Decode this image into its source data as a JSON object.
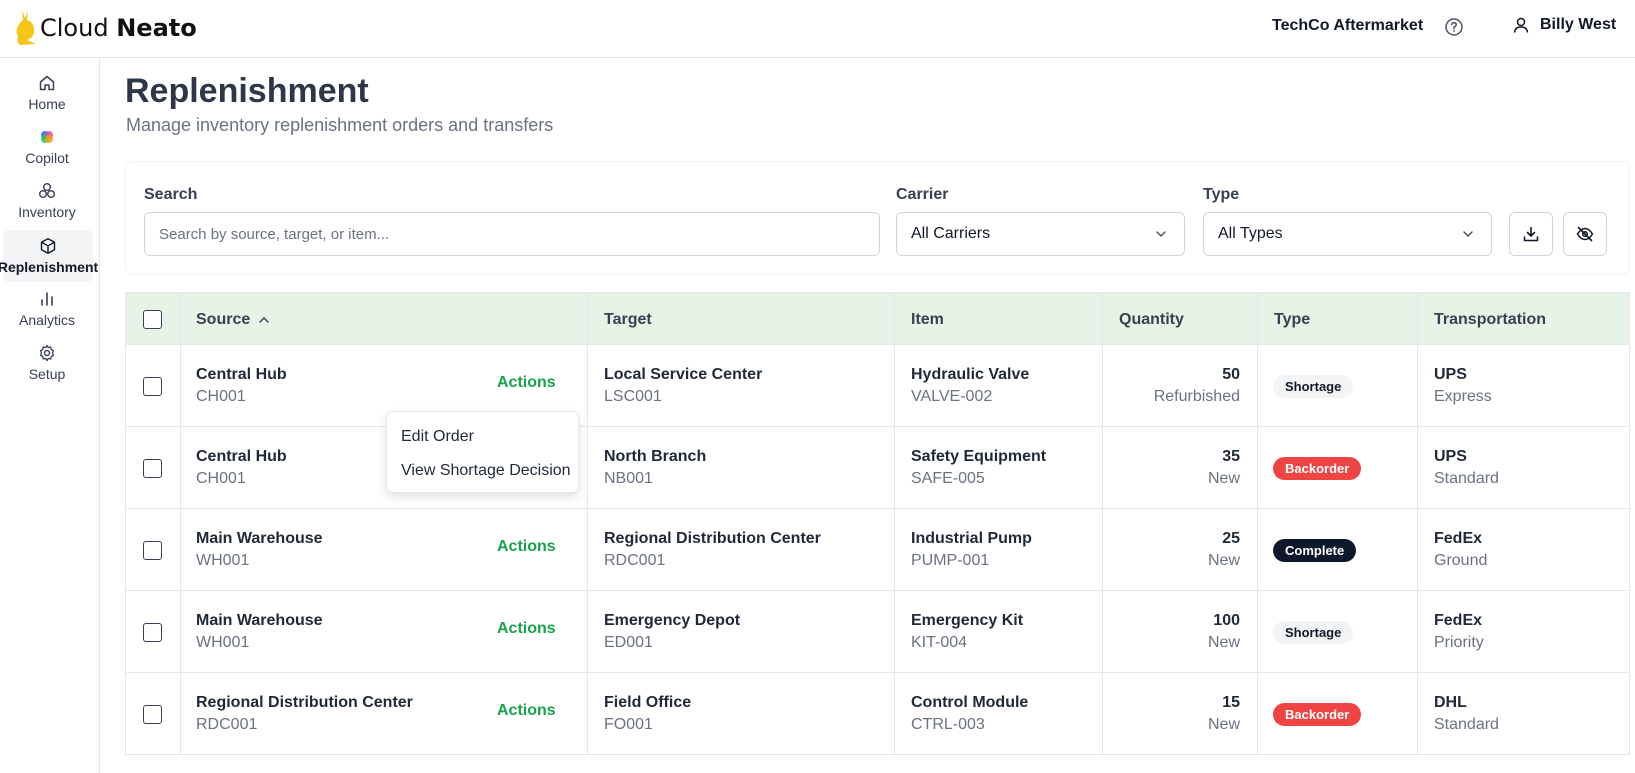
{
  "header": {
    "brand_prefix": "Cloud",
    "brand_name": "Neato",
    "org": "TechCo Aftermarket",
    "user_name": "Billy West"
  },
  "sidebar": {
    "items": [
      {
        "label": "Home",
        "icon": "home-icon"
      },
      {
        "label": "Copilot",
        "icon": "copilot-icon"
      },
      {
        "label": "Inventory",
        "icon": "inventory-icon"
      },
      {
        "label": "Replenishment",
        "icon": "package-icon",
        "active": true
      },
      {
        "label": "Analytics",
        "icon": "bar-chart-icon"
      },
      {
        "label": "Setup",
        "icon": "gear-icon"
      }
    ]
  },
  "page": {
    "title": "Replenishment",
    "subtitle": "Manage inventory replenishment orders and transfers"
  },
  "filters": {
    "search_label": "Search",
    "search_placeholder": "Search by source, target, or item...",
    "search_value": "",
    "carrier_label": "Carrier",
    "carrier_value": "All Carriers",
    "type_label": "Type",
    "type_value": "All Types"
  },
  "table": {
    "columns": {
      "source": "Source",
      "target": "Target",
      "item": "Item",
      "quantity": "Quantity",
      "type": "Type",
      "transportation": "Transportation"
    },
    "actions_label": "Actions",
    "rows": [
      {
        "source": "Central Hub",
        "source_code": "CH001",
        "target": "Local Service Center",
        "target_code": "LSC001",
        "item": "Hydraulic Valve",
        "item_code": "VALVE-002",
        "qty": "50",
        "condition": "Refurbished",
        "type": "Shortage",
        "carrier": "UPS",
        "service": "Express"
      },
      {
        "source": "Central Hub",
        "source_code": "CH001",
        "target": "North Branch",
        "target_code": "NB001",
        "item": "Safety Equipment",
        "item_code": "SAFE-005",
        "qty": "35",
        "condition": "New",
        "type": "Backorder",
        "carrier": "UPS",
        "service": "Standard"
      },
      {
        "source": "Main Warehouse",
        "source_code": "WH001",
        "target": "Regional Distribution Center",
        "target_code": "RDC001",
        "item": "Industrial Pump",
        "item_code": "PUMP-001",
        "qty": "25",
        "condition": "New",
        "type": "Complete",
        "carrier": "FedEx",
        "service": "Ground"
      },
      {
        "source": "Main Warehouse",
        "source_code": "WH001",
        "target": "Emergency Depot",
        "target_code": "ED001",
        "item": "Emergency Kit",
        "item_code": "KIT-004",
        "qty": "100",
        "condition": "New",
        "type": "Shortage",
        "carrier": "FedEx",
        "service": "Priority"
      },
      {
        "source": "Regional Distribution Center",
        "source_code": "RDC001",
        "target": "Field Office",
        "target_code": "FO001",
        "item": "Control Module",
        "item_code": "CTRL-003",
        "qty": "15",
        "condition": "New",
        "type": "Backorder",
        "carrier": "DHL",
        "service": "Standard"
      }
    ]
  },
  "menu": {
    "edit": "Edit Order",
    "view_shortage": "View Shortage Decision"
  },
  "colors": {
    "accent_green": "#16a34a",
    "header_bg": "#e6f4e8",
    "backorder": "#ef4444",
    "complete": "#0f172a"
  }
}
